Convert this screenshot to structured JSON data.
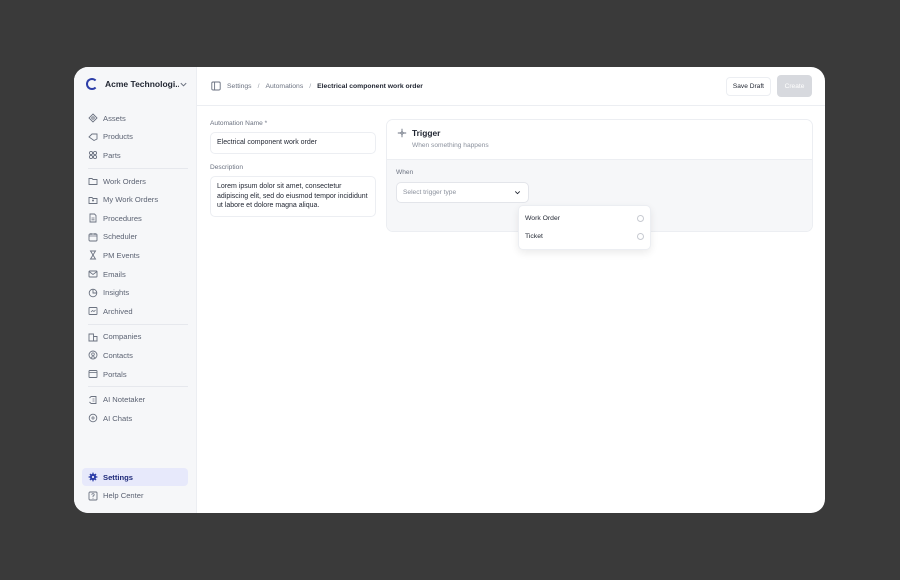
{
  "org": {
    "name": "Acme Technologi..."
  },
  "nav": {
    "group1": [
      {
        "label": "Assets",
        "icon": "assets-icon"
      },
      {
        "label": "Products",
        "icon": "products-icon"
      },
      {
        "label": "Parts",
        "icon": "parts-icon"
      }
    ],
    "group2": [
      {
        "label": "Work Orders",
        "icon": "folder-icon"
      },
      {
        "label": "My Work Orders",
        "icon": "user-folder-icon"
      },
      {
        "label": "Procedures",
        "icon": "document-icon"
      },
      {
        "label": "Scheduler",
        "icon": "calendar-icon"
      },
      {
        "label": "PM Events",
        "icon": "hourglass-icon"
      },
      {
        "label": "Emails",
        "icon": "mail-icon"
      },
      {
        "label": "Insights",
        "icon": "chart-icon"
      },
      {
        "label": "Archived",
        "icon": "archive-icon"
      }
    ],
    "group3": [
      {
        "label": "Companies",
        "icon": "building-icon"
      },
      {
        "label": "Contacts",
        "icon": "contact-icon"
      },
      {
        "label": "Portals",
        "icon": "portal-icon"
      }
    ],
    "group4": [
      {
        "label": "AI Notetaker",
        "icon": "notetaker-icon"
      },
      {
        "label": "AI Chats",
        "icon": "chat-icon"
      }
    ],
    "settings": "Settings",
    "help": "Help Center"
  },
  "breadcrumb": {
    "item1": "Settings",
    "item2": "Automations",
    "current": "Electrical component work order"
  },
  "toolbar": {
    "save_draft": "Save Draft",
    "create": "Create"
  },
  "form": {
    "name_label": "Automation Name *",
    "name_value": "Electrical component work order",
    "description_label": "Description",
    "description_value": "Lorem ipsum dolor sit amet, consectetur adipiscing elit, sed do eiusmod tempor incididunt ut labore et dolore magna aliqua."
  },
  "trigger": {
    "title": "Trigger",
    "subtitle": "When something happens",
    "when_label": "When",
    "select_placeholder": "Select trigger type",
    "options": [
      "Work Order",
      "Ticket"
    ]
  },
  "colors": {
    "accent": "#2d3ea8",
    "active_bg": "#e7e9fb"
  }
}
